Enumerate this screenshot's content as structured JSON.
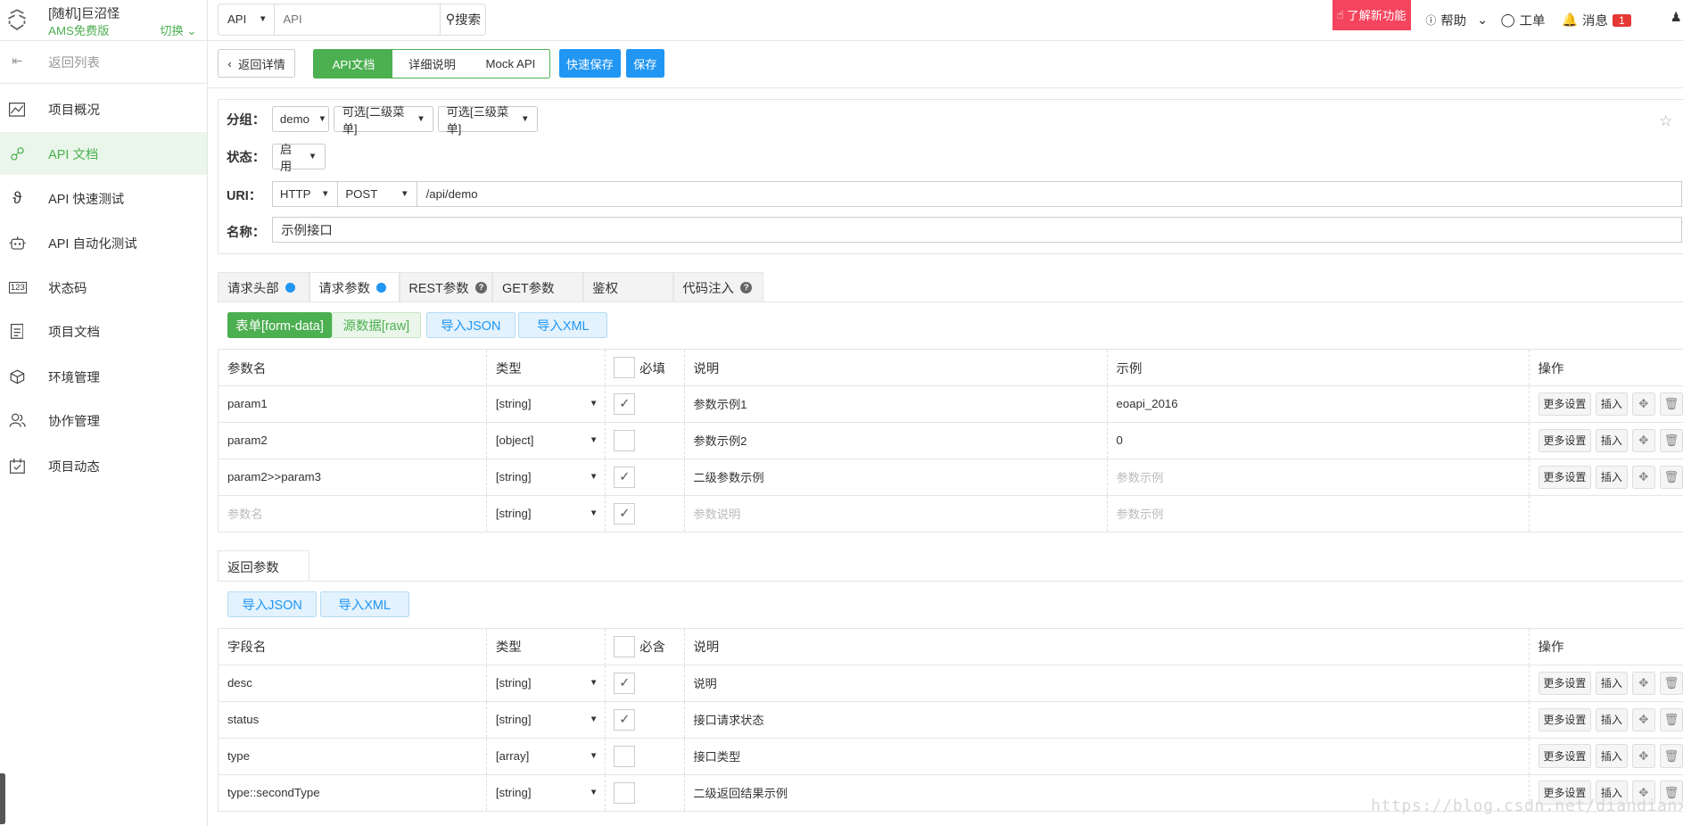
{
  "topbar": {
    "project_name": "[随机]巨沼怪",
    "plan": "AMS免费版",
    "switch_label": "切换",
    "search": {
      "scope": "API",
      "placeholder": "API",
      "button": "搜索"
    },
    "new_feature": "了解新功能",
    "help": "帮助",
    "ticket": "工单",
    "messages": "消息",
    "message_count": "1"
  },
  "sidebar": {
    "back": "返回列表",
    "items": [
      {
        "label": "项目概况",
        "icon": "chart-icon"
      },
      {
        "label": "API 文档",
        "icon": "api-doc-icon"
      },
      {
        "label": "API 快速测试",
        "icon": "lightning-icon"
      },
      {
        "label": "API 自动化测试",
        "icon": "robot-icon"
      },
      {
        "label": "状态码",
        "icon": "status-code-icon"
      },
      {
        "label": "项目文档",
        "icon": "document-icon"
      },
      {
        "label": "环境管理",
        "icon": "cube-icon"
      },
      {
        "label": "协作管理",
        "icon": "team-icon"
      },
      {
        "label": "项目动态",
        "icon": "calendar-icon"
      }
    ],
    "active_index": 1
  },
  "actionbar": {
    "back": "返回详情",
    "tabs": [
      "API文档",
      "详细说明",
      "Mock API"
    ],
    "quick_save": "快速保存",
    "save": "保存"
  },
  "form": {
    "group_label": "分组：",
    "group_values": [
      "demo",
      "可选[二级菜单]",
      "可选[三级菜单]"
    ],
    "status_label": "状态：",
    "status_value": "启用",
    "uri_label": "URI：",
    "protocol": "HTTP",
    "method": "POST",
    "uri": "/api/demo",
    "name_label": "名称：",
    "name": "示例接口"
  },
  "request_tabs": [
    {
      "label": "请求头部",
      "dot": true
    },
    {
      "label": "请求参数",
      "dot": true
    },
    {
      "label": "REST参数",
      "help": true
    },
    {
      "label": "GET参数"
    },
    {
      "label": "鉴权"
    },
    {
      "label": "代码注入",
      "help": true
    }
  ],
  "request_buttons": [
    "表单[form-data]",
    "源数据[raw]",
    "导入JSON",
    "导入XML"
  ],
  "request_table": {
    "headers": [
      "参数名",
      "类型",
      "必填",
      "说明",
      "示例",
      "操作"
    ],
    "rows": [
      {
        "name": "param1",
        "type": "[string]",
        "required": true,
        "desc": "参数示例1",
        "example": "eoapi_2016"
      },
      {
        "name": "param2",
        "type": "[object]",
        "required": false,
        "desc": "参数示例2",
        "example": "0"
      },
      {
        "name": "param2>>param3",
        "type": "[string]",
        "required": true,
        "desc": "二级参数示例",
        "example": "参数示例",
        "example_placeholder": true
      }
    ],
    "new_row": {
      "name": "参数名",
      "type": "[string]",
      "desc": "参数说明",
      "example": "参数示例"
    },
    "more": "更多设置",
    "insert": "插入"
  },
  "response": {
    "tab": "返回参数",
    "buttons": [
      "导入JSON",
      "导入XML"
    ],
    "headers": [
      "字段名",
      "类型",
      "必含",
      "说明",
      "操作"
    ],
    "rows": [
      {
        "name": "desc",
        "type": "[string]",
        "required": true,
        "desc": "说明"
      },
      {
        "name": "status",
        "type": "[string]",
        "required": true,
        "desc": "接口请求状态"
      },
      {
        "name": "type",
        "type": "[array]",
        "required": false,
        "desc": "接口类型"
      },
      {
        "name": "type::secondType",
        "type": "[string]",
        "required": false,
        "desc": "二级返回结果示例"
      }
    ]
  },
  "watermark": "https://blog.csdn.net/diandianxiyu"
}
